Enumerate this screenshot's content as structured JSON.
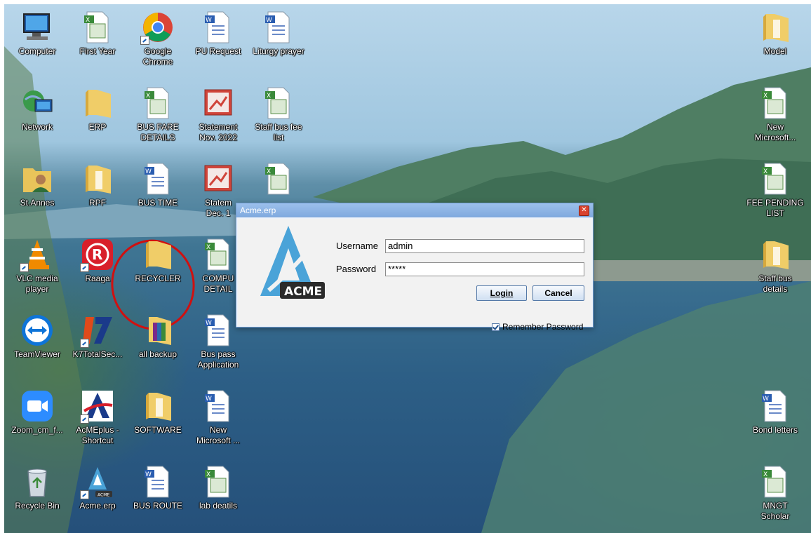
{
  "icons": {
    "computer": "Computer",
    "first_year": "First Year",
    "chrome": "Google\nChrome",
    "pu_request": "PU Request",
    "liturgy": "Liturgy prayer",
    "model": "Model",
    "network": "Network",
    "erp": "ERP",
    "bus_fare": "BUS FARE\nDETAILS",
    "statement_nov": "Statement\nNov. 2022",
    "staff_bus_fee": "Staff bus fee\nlist",
    "new_microsoft_right": "New\nMicrosoft...",
    "st_annes": "St.Annes",
    "rpf": "RPF",
    "bus_time": "BUS TIME",
    "statement_dec": "Statem\nDec. 1",
    "fee_pending": "FEE PENDING\nLIST",
    "vlc": "VLC media\nplayer",
    "raaga": "Raaga",
    "recycler": "RECYCLER",
    "compu": "COMPU\nDETAIL",
    "staff_bus_details": "Staff bus\ndetails",
    "teamviewer": "TeamViewer",
    "k7": "K7TotalSec...",
    "all_backup": "all backup",
    "bus_pass": "Bus pass\nApplication",
    "zoom": "Zoom_cm_f...",
    "acmeplus": "AcMEplus -\nShortcut",
    "software": "SOFTWARE",
    "new_microsoft": "New\nMicrosoft ...",
    "bond_letters": "Bond letters",
    "recycle_bin": "Recycle Bin",
    "acme_erp": "Acme.erp",
    "bus_route": "BUS ROUTE",
    "lab_details": "lab deatils",
    "mngt": "MNGT\nScholar"
  },
  "dialog": {
    "title": "Acme.erp",
    "logo_text": "ACME",
    "username_label": "Username",
    "username_value": "admin",
    "password_label": "Password",
    "password_value": "*****",
    "login_label": "Login",
    "cancel_label": "Cancel",
    "remember_label": "Remember Password",
    "remember_checked": true
  },
  "colors": {
    "annotation": "#d01010",
    "acme_blue": "#4aa3d8",
    "title_bar": "#8fb6e6"
  }
}
